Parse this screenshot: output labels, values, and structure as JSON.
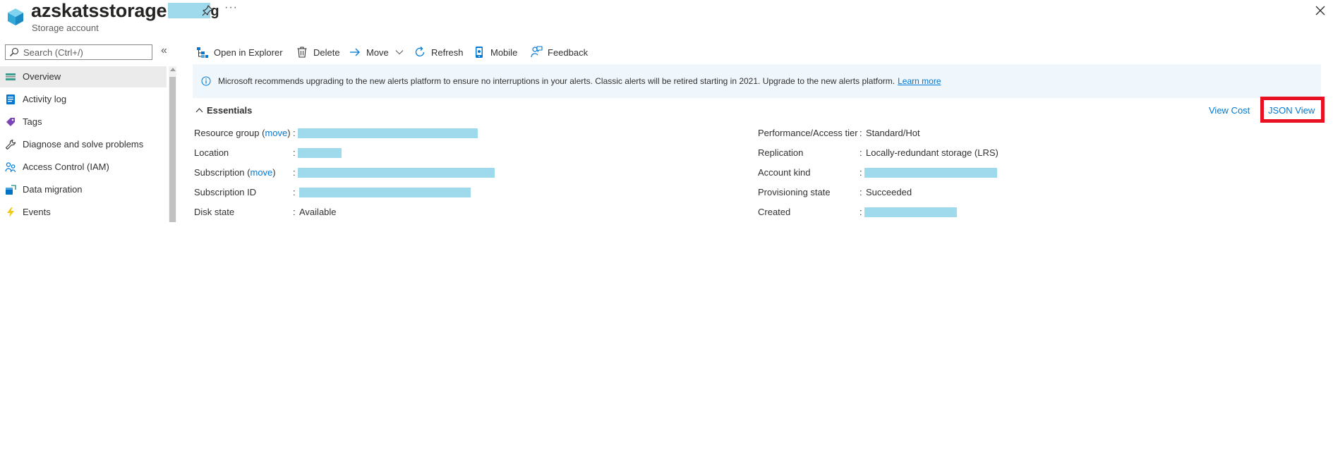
{
  "header": {
    "title": "azskatsstorage",
    "title_suffix_redacted": true,
    "subtitle": "Storage account",
    "more_label": "···"
  },
  "sidebar": {
    "search_placeholder": "Search (Ctrl+/)",
    "collapse_label": "«",
    "items": [
      {
        "label": "Overview",
        "icon": "overview-icon",
        "active": true
      },
      {
        "label": "Activity log",
        "icon": "activity-log-icon",
        "active": false
      },
      {
        "label": "Tags",
        "icon": "tag-icon",
        "active": false
      },
      {
        "label": "Diagnose and solve problems",
        "icon": "wrench-icon",
        "active": false
      },
      {
        "label": "Access Control (IAM)",
        "icon": "people-icon",
        "active": false
      },
      {
        "label": "Data migration",
        "icon": "data-migration-icon",
        "active": false
      },
      {
        "label": "Events",
        "icon": "lightning-icon",
        "active": false
      }
    ]
  },
  "toolbar": {
    "open_in_explorer": "Open in Explorer",
    "delete": "Delete",
    "move": "Move",
    "refresh": "Refresh",
    "mobile": "Mobile",
    "feedback": "Feedback"
  },
  "banner": {
    "text": "Microsoft recommends upgrading to the new alerts platform to ensure no interruptions in your alerts. Classic alerts will be retired starting in 2021. Upgrade to the new alerts platform.",
    "link": "Learn more"
  },
  "essentials": {
    "title": "Essentials",
    "view_cost": "View Cost",
    "json_view": "JSON View",
    "left": [
      {
        "label": "Resource group",
        "link": "move",
        "value": "",
        "redacted": true
      },
      {
        "label": "Location",
        "link": "",
        "value": "",
        "redacted": true
      },
      {
        "label": "Subscription",
        "link": "move",
        "value": "",
        "redacted": true
      },
      {
        "label": "Subscription ID",
        "link": "",
        "value": "",
        "redacted": true
      },
      {
        "label": "Disk state",
        "link": "",
        "value": "Available",
        "redacted": false
      }
    ],
    "right": [
      {
        "label": "Performance/Access tier",
        "value": "Standard/Hot",
        "redacted": false
      },
      {
        "label": "Replication",
        "value": "Locally-redundant storage (LRS)",
        "redacted": false
      },
      {
        "label": "Account kind",
        "value": "",
        "redacted": true
      },
      {
        "label": "Provisioning state",
        "value": "Succeeded",
        "redacted": false
      },
      {
        "label": "Created",
        "value": "",
        "redacted": true
      }
    ],
    "colon": ":"
  },
  "colors": {
    "accent": "#0078d4",
    "highlight_box": "#e81123",
    "banner_bg": "#eff6fc",
    "redaction": "#9fd9ec"
  }
}
